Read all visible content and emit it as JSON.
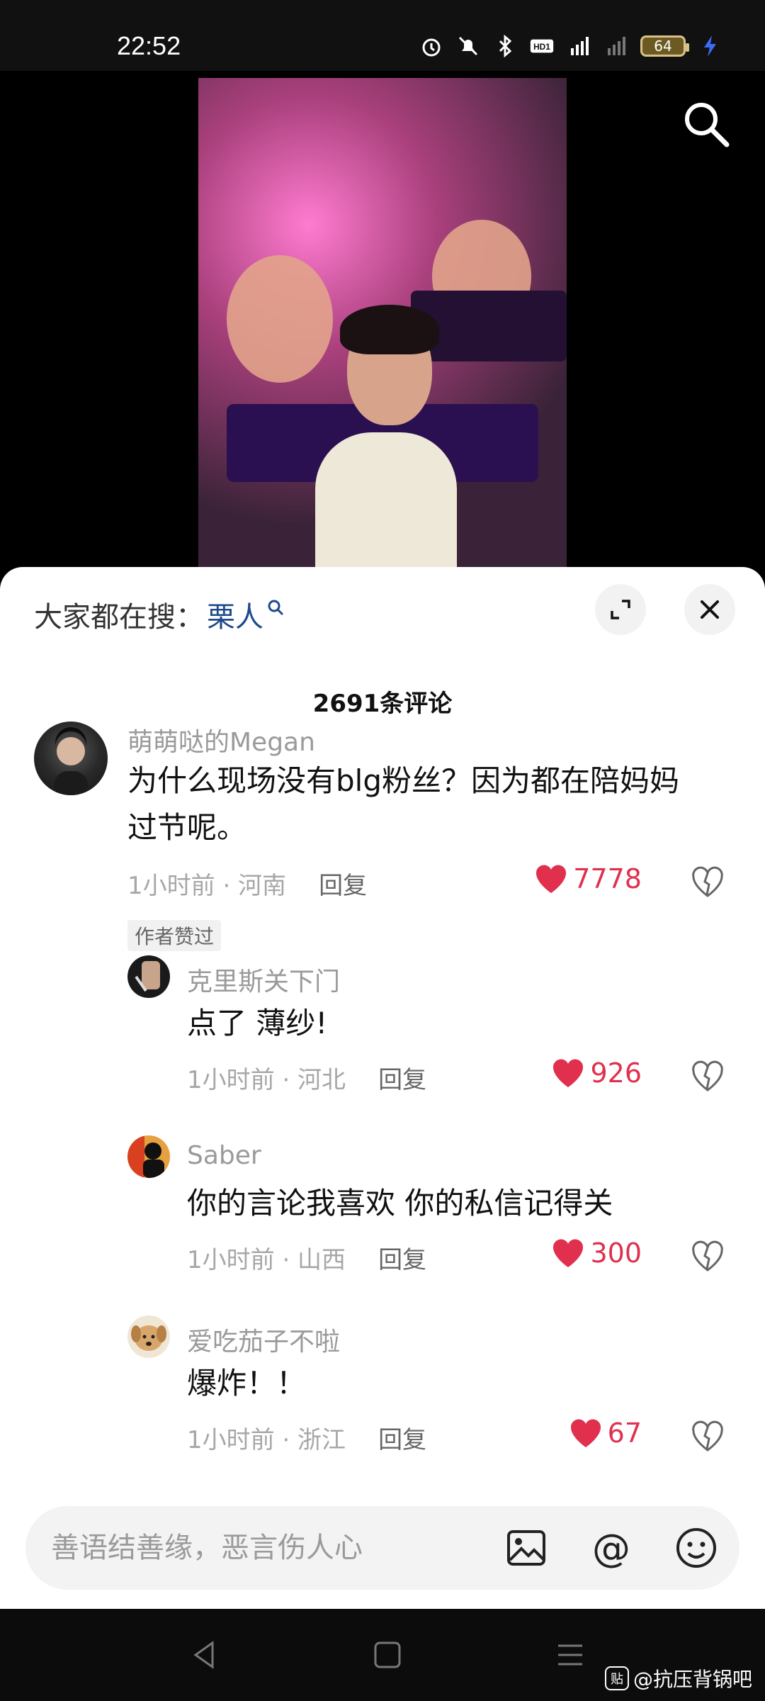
{
  "status_bar": {
    "time": "22:52",
    "battery": "64"
  },
  "hot_search": {
    "prefix": "大家都在搜：",
    "term": "栗人"
  },
  "comment_count": "2691条评论",
  "comments": [
    {
      "username": "萌萌哒的Megan",
      "text_line1": "为什么现场没有blg粉丝？因为都在陪妈妈",
      "text_line2": "过节呢。",
      "time_location": "1小时前 · 河南",
      "reply": "回复",
      "likes": "7778",
      "badge": "作者赞过"
    },
    {
      "username": "克里斯关下门",
      "text": "点了 薄纱!",
      "time_location": "1小时前 · 河北",
      "reply": "回复",
      "likes": "926"
    },
    {
      "username": "Saber",
      "text": "你的言论我喜欢 你的私信记得关",
      "time_location": "1小时前 · 山西",
      "reply": "回复",
      "likes": "300"
    },
    {
      "username": "爱吃茄子不啦",
      "text": "爆炸！！",
      "time_location": "1小时前 · 浙江",
      "reply": "回复",
      "likes": "67"
    }
  ],
  "input": {
    "placeholder": "善语结善缘，恶言伤人心"
  },
  "watermark": {
    "badge": "贴",
    "text": "@抗压背锅吧"
  },
  "colors": {
    "like": "#e0304e",
    "link": "#1e4a8c"
  }
}
